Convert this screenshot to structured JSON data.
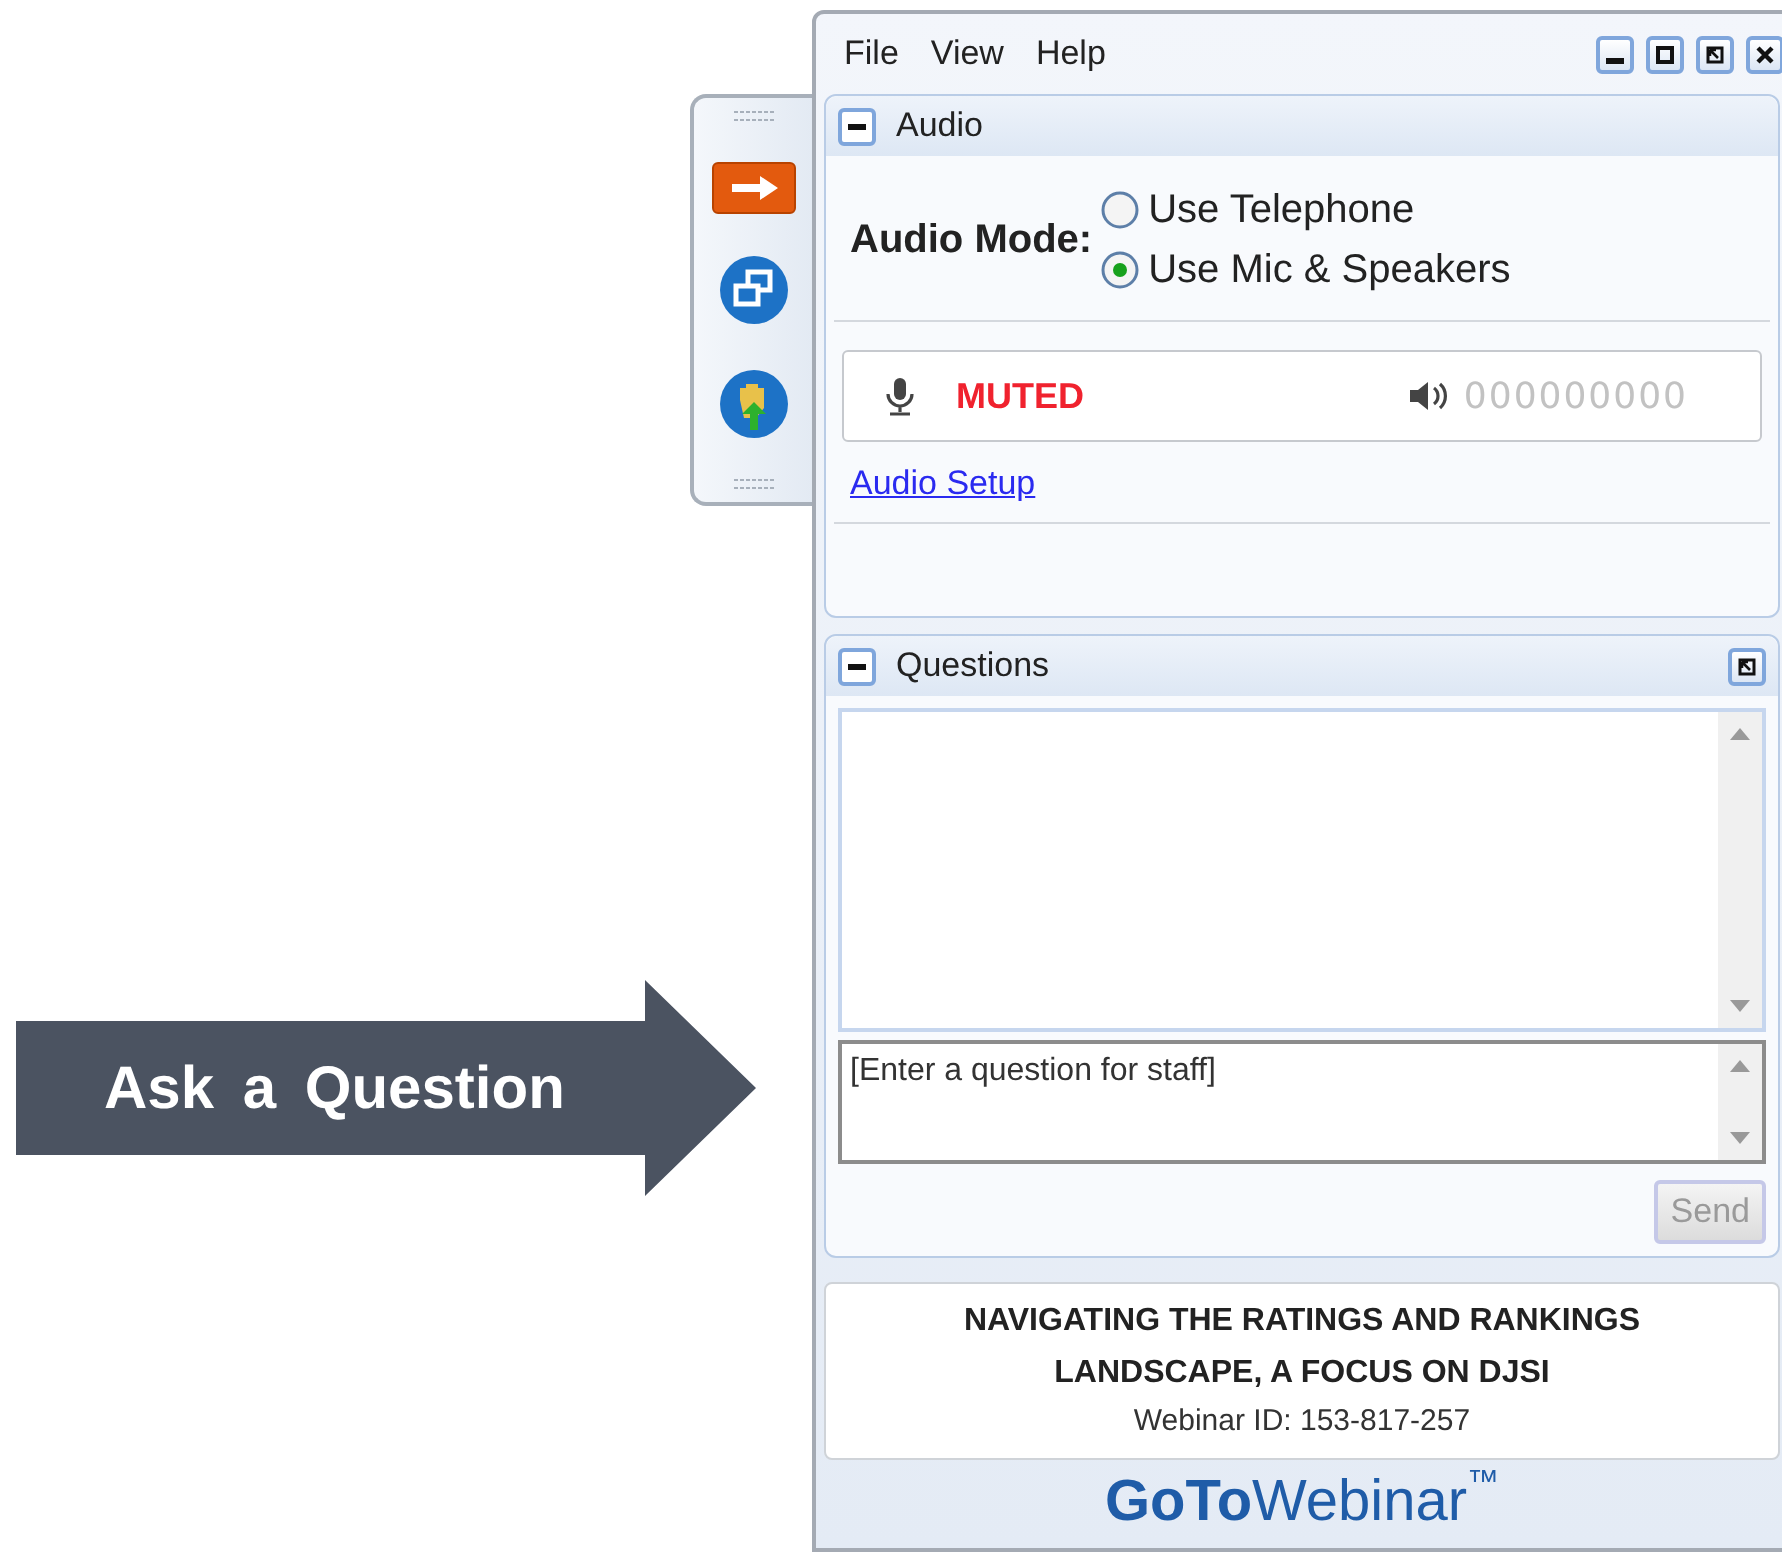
{
  "menu": [
    "File",
    "View",
    "Help"
  ],
  "audio": {
    "title": "Audio",
    "expanded": true,
    "mode_label": "Audio Mode:",
    "options": [
      {
        "label": "Use Telephone",
        "selected": false
      },
      {
        "label": "Use Mic & Speakers",
        "selected": true
      }
    ],
    "mic_status": "MUTED",
    "speaker_reading": "000000000",
    "setup_link": "Audio Setup"
  },
  "questions": {
    "title": "Questions",
    "expanded": true,
    "input": {
      "placeholder": "[Enter a question for staff]"
    },
    "send": {
      "label": "Send",
      "disabled": true
    }
  },
  "webinar": {
    "title": "NAVIGATING THE RATINGS AND RANKINGS LANDSCAPE, A FOCUS ON DJSI",
    "id_text": "Webinar ID: 153-817-257"
  },
  "logo": {
    "bold": "GoTo",
    "light": "Webinar",
    "mark": "™"
  },
  "callout": "Ask a Question"
}
